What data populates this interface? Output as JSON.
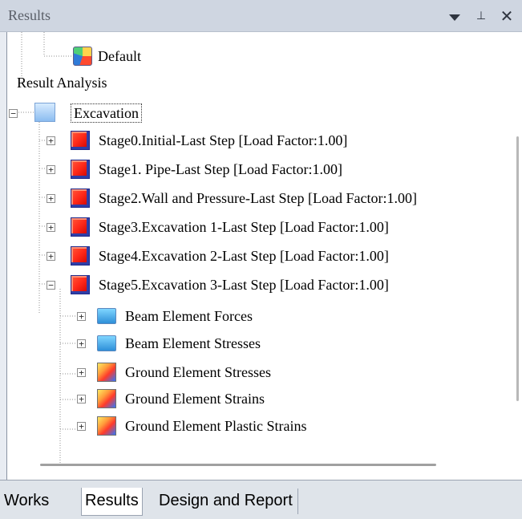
{
  "panel": {
    "title": "Results",
    "controls": {
      "menu_icon": "dropdown-icon",
      "pin_icon": "pin-icon",
      "close_icon": "close-icon"
    }
  },
  "tree": {
    "items": [
      {
        "label": "Default"
      },
      {
        "label": "Result Analysis"
      },
      {
        "label": "Excavation",
        "expanded": true,
        "focused": true
      },
      {
        "label": "Stage0.Initial-Last Step [Load Factor:1.00]",
        "expanded": false
      },
      {
        "label": "Stage1. Pipe-Last Step [Load Factor:1.00]",
        "expanded": false
      },
      {
        "label": "Stage2.Wall and Pressure-Last Step [Load Factor:1.00]",
        "expanded": false
      },
      {
        "label": "Stage3.Excavation 1-Last Step [Load Factor:1.00]",
        "expanded": false
      },
      {
        "label": "Stage4.Excavation 2-Last Step [Load Factor:1.00]",
        "expanded": false
      },
      {
        "label": "Stage5.Excavation 3-Last Step [Load Factor:1.00]",
        "expanded": true
      },
      {
        "label": "Beam Element Forces",
        "expanded": false
      },
      {
        "label": "Beam Element Stresses",
        "expanded": false
      },
      {
        "label": "Ground Element Stresses",
        "expanded": false
      },
      {
        "label": "Ground Element Strains",
        "expanded": false
      },
      {
        "label": "Ground Element Plastic Strains",
        "expanded": false
      }
    ]
  },
  "tabs": [
    {
      "label": "Works",
      "active": false
    },
    {
      "label": "Results",
      "active": true
    },
    {
      "label": "Design and Report",
      "active": false
    }
  ]
}
